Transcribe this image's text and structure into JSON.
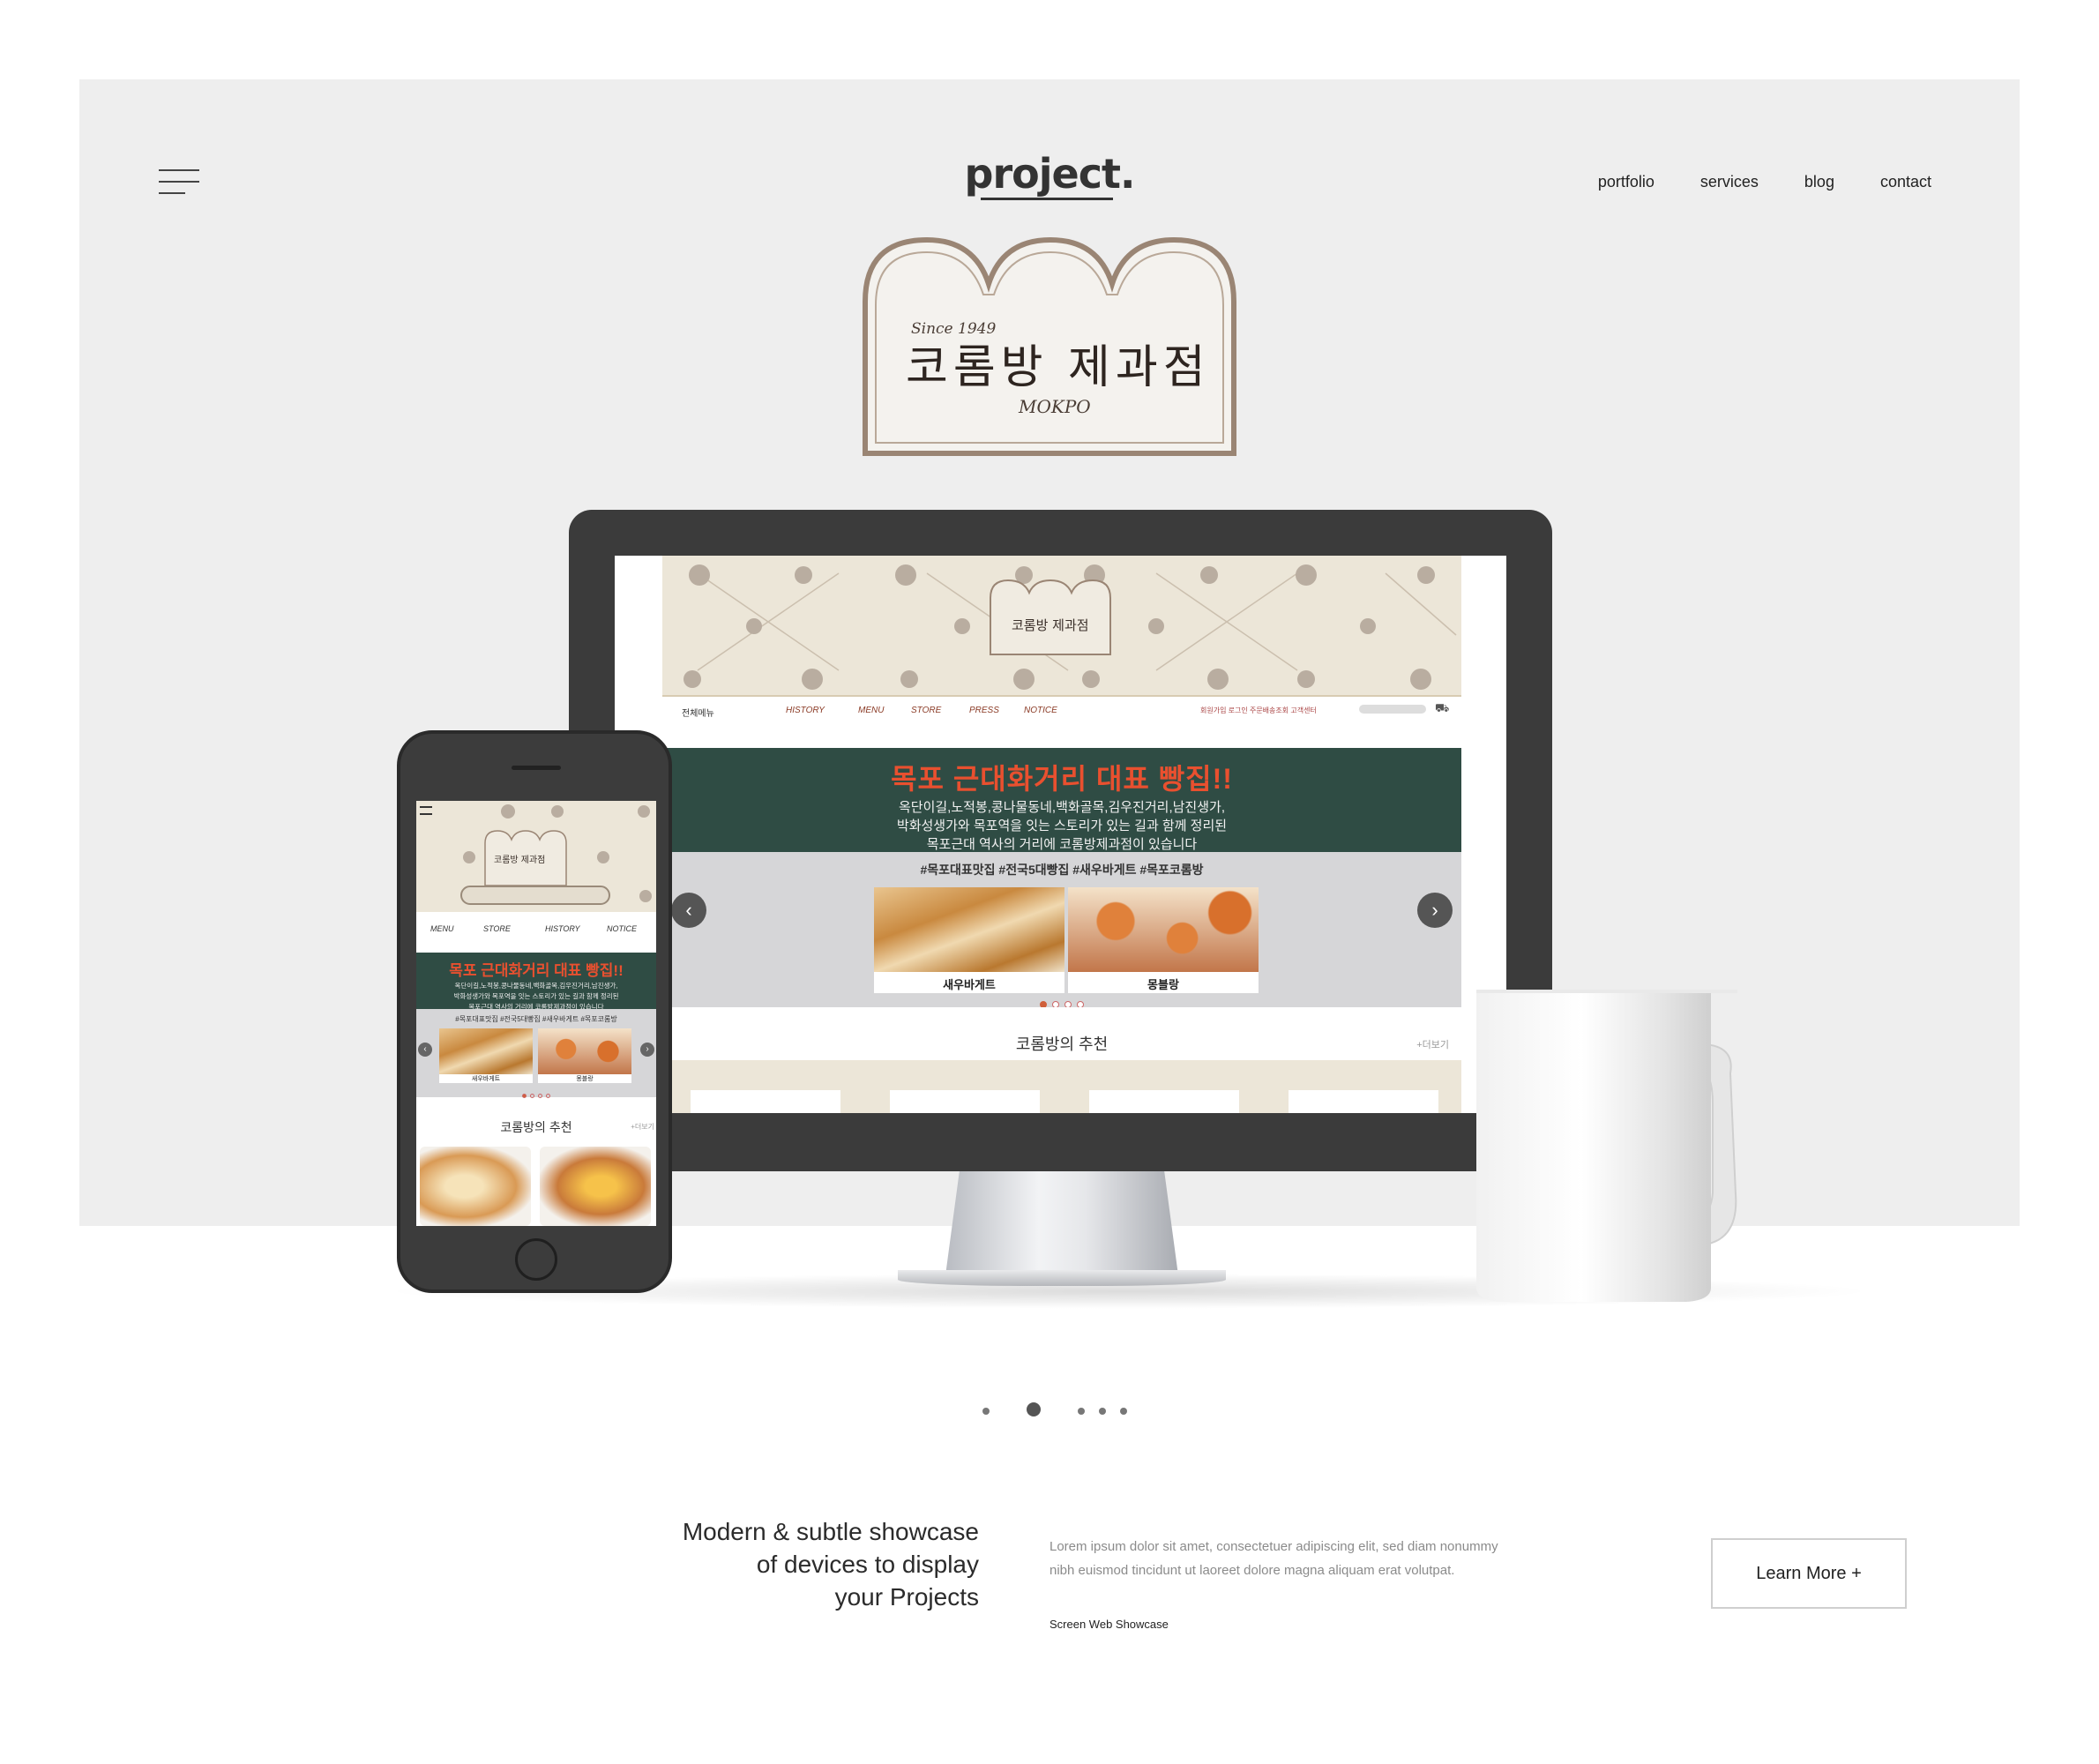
{
  "header": {
    "brand": "project.",
    "nav": [
      "portfolio",
      "services",
      "blog",
      "contact"
    ]
  },
  "logo_badge": {
    "since": "Since 1949",
    "name": "코롬방 제과점",
    "city": "MOKPO"
  },
  "desktop_screen": {
    "nav_items": [
      "전체메뉴",
      "HISTORY",
      "MENU",
      "STORE",
      "PRESS",
      "NOTICE"
    ],
    "util_links": "회원가입  로그인   주문배송조회  고객센터",
    "banner_title": "목포 근대화거리 대표 빵집!!",
    "banner_lines": [
      "옥단이길,노적봉,콩나물동네,백화골목,김우진거리,남진생가,",
      "박화성생가와 목포역을 잇는 스토리가 있는 길과 함께 정리된",
      "목포근대 역사의 거리에 코롬방제과점이 있습니다"
    ],
    "hashtags": "#목포대표맛집 #전국5대빵집 #새우바게트 #목포코롬방",
    "products": [
      "새우바게트",
      "몽블랑"
    ],
    "recommend_title": "코롬방의 추천",
    "more_link": "+더보기"
  },
  "phone_screen": {
    "nav_items": [
      "MENU",
      "STORE",
      "HISTORY",
      "NOTICE"
    ],
    "banner_title": "목포 근대화거리 대표 빵집!!",
    "banner_lines": [
      "옥단이길,노적봉,콩나물동네,백화골목,김우진거리,남진생가,",
      "박화성생가와 목포역을 잇는 스토리가 있는 길과 함께 정리된",
      "목포근대 역사의 거리에 코롬방제과점이 있습니다"
    ],
    "hashtags": "#목포대표맛집 #전국5대빵집 #새우바게트 #목포코롬방",
    "products": [
      "새우바게트",
      "몽블랑"
    ],
    "recommend_title": "코롬방의 추천",
    "more_link": "+더보기"
  },
  "pager": {
    "count": 5,
    "active_index": 1
  },
  "showcase": {
    "headline_lines": [
      "Modern & subtle showcase",
      "of devices to display",
      "your Projects"
    ],
    "lorem_lines": [
      "Lorem ipsum dolor sit amet, consectetuer adipiscing elit, sed diam nonummy",
      "nibh euismod tincidunt ut laoreet dolore magna aliquam erat volutpat."
    ],
    "caption": "Screen Web Showcase",
    "cta_label": "Learn More +"
  },
  "colors": {
    "hero_bg": "#eeeeee",
    "bakery_beige": "#ece6d8",
    "bakery_green": "#2f4c44",
    "bakery_red": "#e9502f",
    "device_dark": "#3b3b3b"
  }
}
